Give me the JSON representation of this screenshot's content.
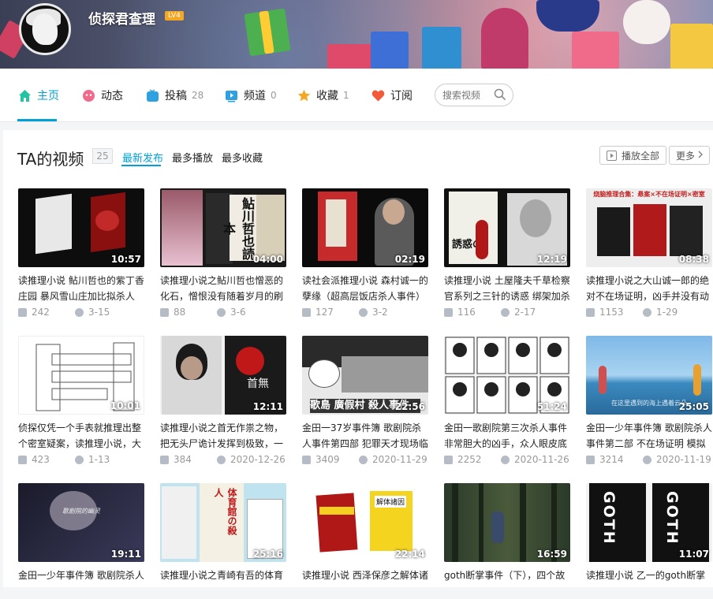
{
  "user": {
    "name": "侦探君查理",
    "level": "LV4"
  },
  "nav": {
    "items": [
      {
        "label": "主页",
        "count": ""
      },
      {
        "label": "动态",
        "count": ""
      },
      {
        "label": "投稿",
        "count": "28"
      },
      {
        "label": "频道",
        "count": "0"
      },
      {
        "label": "收藏",
        "count": "1"
      },
      {
        "label": "订阅",
        "count": ""
      }
    ],
    "search_placeholder": "搜索视频"
  },
  "section": {
    "title": "TA的视频",
    "count": "25",
    "sorts": [
      "最新发布",
      "最多播放",
      "最多收藏"
    ],
    "play_all": "播放全部",
    "more": "更多"
  },
  "videos": [
    {
      "duration": "10:57",
      "title": "读推理小说 鲇川哲也的紫丁香庄园 暴风雪山庄加比拟杀人",
      "plays": "242",
      "date": "3-15"
    },
    {
      "duration": "04:00",
      "title": "读推理小说之鲇川哲也憎恶的化石，憎恨没有随着岁月的刷",
      "plays": "88",
      "date": "3-6"
    },
    {
      "duration": "02:19",
      "title": "读社会派推理小说 森村诚一的孽缘（超高层饭店杀人事件）",
      "plays": "127",
      "date": "3-2"
    },
    {
      "duration": "12:19",
      "title": "读推理小说 土屋隆夫千草检察官系列之三针的诱惑 绑架加杀",
      "plays": "116",
      "date": "2-17"
    },
    {
      "duration": "08:38",
      "title": "读推理小说之大山诚一郎的绝对不在场证明，凶手并没有动",
      "plays": "1153",
      "date": "1-29"
    },
    {
      "duration": "10:01",
      "title": "侦探仅凭一个手表就推理出整个密室疑案，读推理小说，大",
      "plays": "423",
      "date": "1-13"
    },
    {
      "duration": "12:11",
      "title": "读推理小说之首无作祟之物，把无头尸诡计发挥到极致，一",
      "plays": "384",
      "date": "2020-12-26"
    },
    {
      "duration": "22:56",
      "title": "金田一37岁事件簿 歌剧院杀人事件第四部 犯罪天才现场临",
      "plays": "3409",
      "date": "2020-11-29"
    },
    {
      "duration": "51:24",
      "title": "金田一歌剧院第三次杀人事件 非常胆大的凶手，众人眼皮底",
      "plays": "2252",
      "date": "2020-11-26"
    },
    {
      "duration": "25:05",
      "title": "金田一少年事件簿 歌剧院杀人事件第二部 不在场证明 模拟",
      "plays": "3214",
      "date": "2020-11-19"
    },
    {
      "duration": "19:11",
      "title": "金田一少年事件簿 歌剧院杀人",
      "plays": "",
      "date": ""
    },
    {
      "duration": "25:16",
      "title": "读推理小说之青崎有吾的体育",
      "plays": "",
      "date": ""
    },
    {
      "duration": "22:14",
      "title": "读推理小说 西泽保彦之解体诸",
      "plays": "",
      "date": ""
    },
    {
      "duration": "16:59",
      "title": "goth断掌事件（下），四个故",
      "plays": "",
      "date": ""
    },
    {
      "duration": "11:07",
      "title": "读推理小说 乙一的goth断掌",
      "plays": "",
      "date": ""
    }
  ],
  "thumb_text": {
    "v2_book": "鮎川哲也読本",
    "v2_small": "憎悪の化石",
    "v4_text": "誘惑の",
    "v5_banner": "烧脑推理合集：悬案×不在场证明×密室",
    "v7_book": "首無",
    "v8_text": "歌島 廣假村 殺人事件",
    "v10_caption": "在这里遇到的海上遇着云朵",
    "v11_caption": "歌剧院的幽灵",
    "v12_book": "体育館の殺人",
    "v13_book": "解体諸因",
    "v15_text": "GOTH"
  },
  "colors": {
    "accent": "#00a1d6",
    "muted": "#999999",
    "text": "#222222"
  }
}
